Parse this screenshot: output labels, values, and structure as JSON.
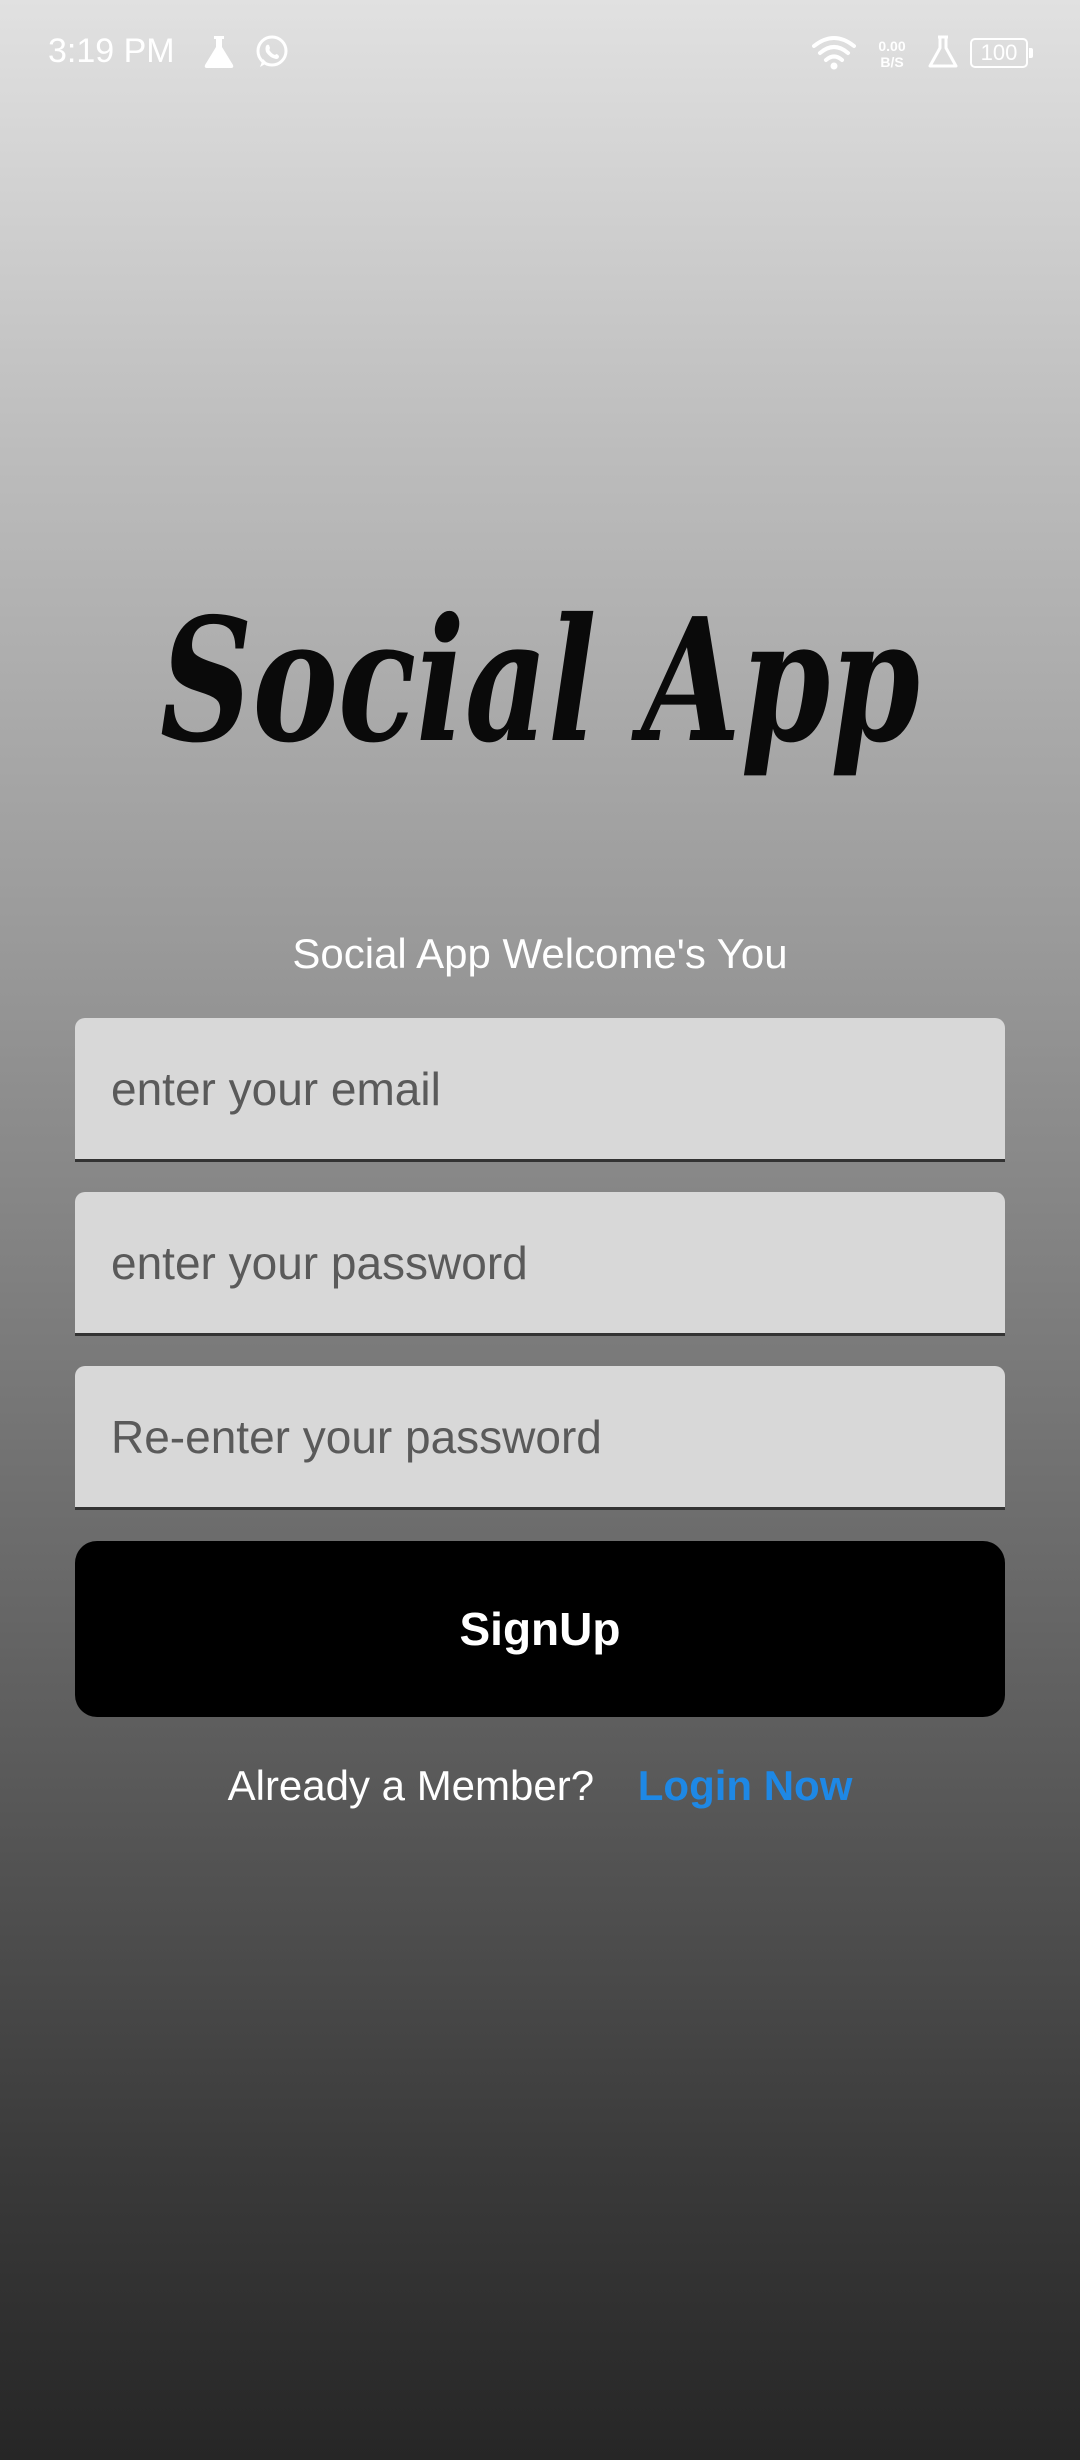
{
  "status_bar": {
    "time": "3:19 PM",
    "net_speed_value": "0.00",
    "net_speed_unit": "B/S",
    "battery": "100",
    "icons": [
      "flask-icon",
      "whatsapp-icon",
      "wifi-icon",
      "flask-icon",
      "battery-icon"
    ]
  },
  "logo": {
    "text": "Social App"
  },
  "welcome_text": "Social App Welcome's You",
  "form": {
    "email_placeholder": "enter your email",
    "password_placeholder": "enter your password",
    "repassword_placeholder": "Re-enter your password",
    "signup_label": "SignUp"
  },
  "footer": {
    "member_text": "Already a Member?",
    "login_label": "Login Now"
  },
  "colors": {
    "button_bg": "#000000",
    "link": "#1e88e5",
    "field_bg": "#d8d8d8"
  }
}
